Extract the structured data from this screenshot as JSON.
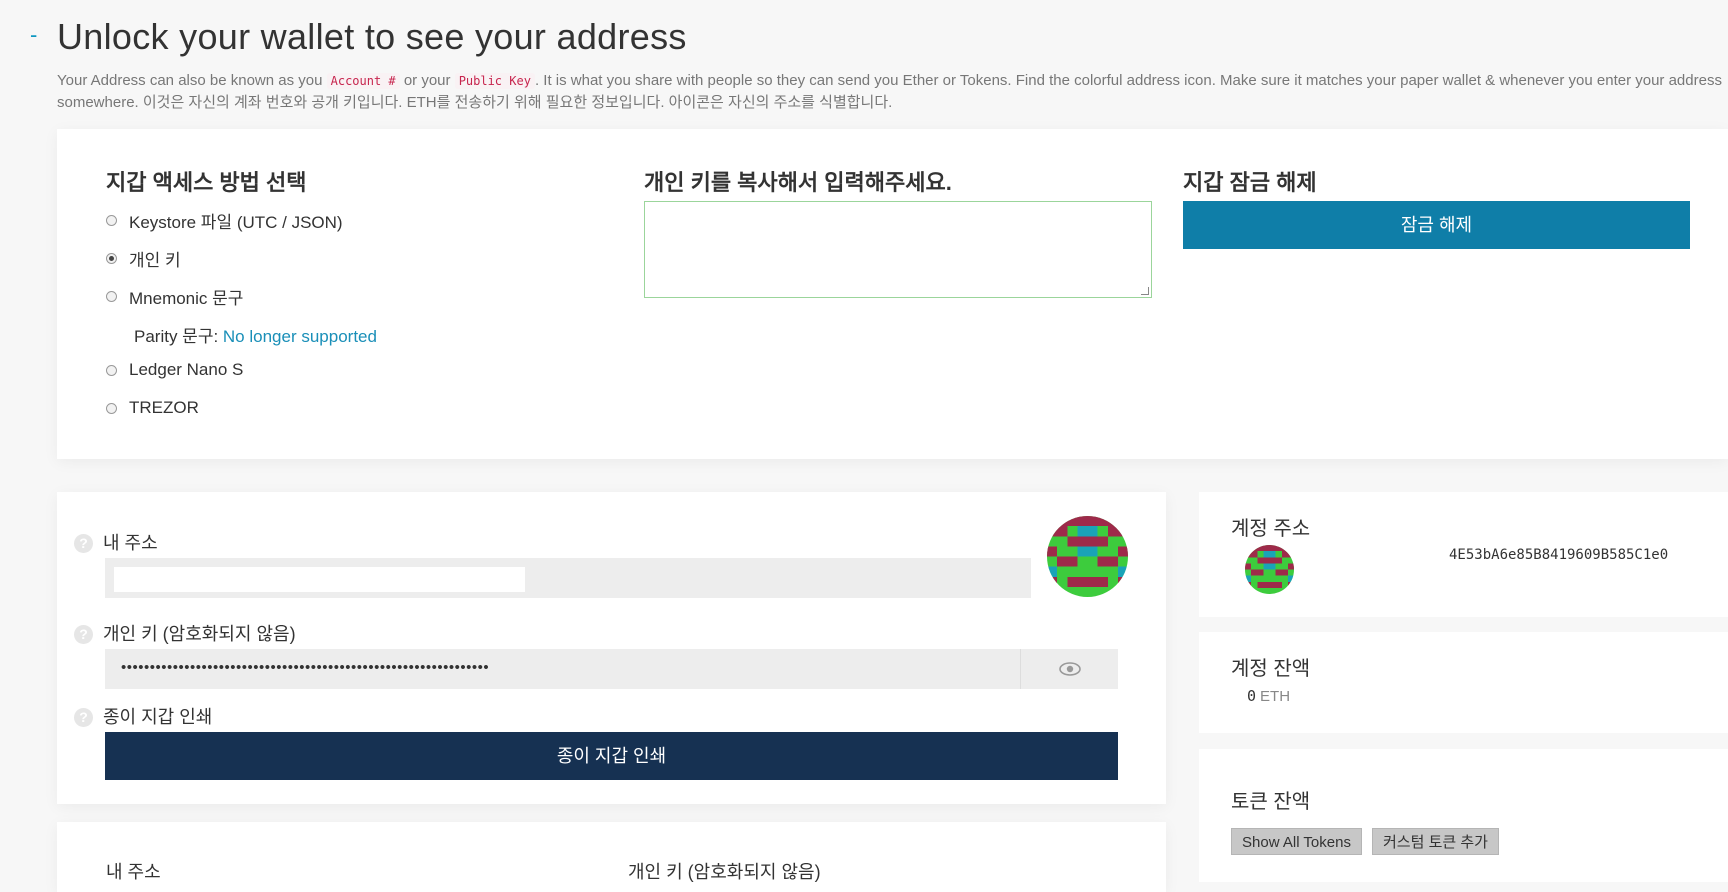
{
  "header": {
    "toggle": "-",
    "title": "Unlock your wallet to see your address",
    "intro_part1": "Your Address can also be known as you ",
    "intro_code1": "Account #",
    "intro_part2": " or your ",
    "intro_code2": "Public Key",
    "intro_part3": ". It is what you share with people so they can send you Ether or Tokens. Find the colorful address icon. Make sure it matches your paper wallet & whenever you enter your address somewhere. 이것은 자신의 계좌 번호와 공개 키입니다. ETH를 전송하기 위해 필요한 정보입니다. 아이콘은 자신의 주소를 식별합니다."
  },
  "access": {
    "heading": "지갑 액세스 방법 선택",
    "options": [
      {
        "label": "Keystore 파일 (UTC / JSON)",
        "selected": false
      },
      {
        "label": "개인 키",
        "selected": true
      },
      {
        "label": "Mnemonic 문구",
        "selected": false
      },
      {
        "label": "Ledger Nano S",
        "selected": false
      },
      {
        "label": "TREZOR",
        "selected": false
      }
    ],
    "parity_label": "Parity 문구: ",
    "parity_link": "No longer supported"
  },
  "private_key_entry": {
    "heading": "개인 키를 복사해서 입력해주세요.",
    "value": ""
  },
  "unlock": {
    "heading": "지갑 잠금 해제",
    "button": "잠금 해제"
  },
  "wallet": {
    "address_label": "내 주소",
    "address_value": "",
    "private_key_label": "개인 키 (암호화되지 않음)",
    "private_key_masked": "••••••••••••••••••••••••••••••••••••••••••••••••••••••••••••••••",
    "print_label": "종이 지갑 인쇄",
    "print_button": "종이 지갑 인쇄",
    "help_glyph": "?",
    "eye_icon": "eye-icon"
  },
  "bottom": {
    "address_label": "내 주소",
    "private_key_label": "개인 키 (암호화되지 않음)"
  },
  "sidebar": {
    "account_address_title": "계정 주소",
    "account_address": "4E53bA6e85B8419609B585C1e0",
    "balance_title": "계정 잔액",
    "balance_value": "0",
    "balance_unit": "ETH",
    "token_title": "토큰 잔액",
    "show_all_tokens": "Show All Tokens",
    "add_custom_token": "커스텀 토큰 추가"
  },
  "colors": {
    "accent": "#0f7ea8",
    "print_button": "#163152",
    "identicon": [
      "#9e2a4a",
      "#3dcc3d",
      "#1aa3b8"
    ]
  }
}
